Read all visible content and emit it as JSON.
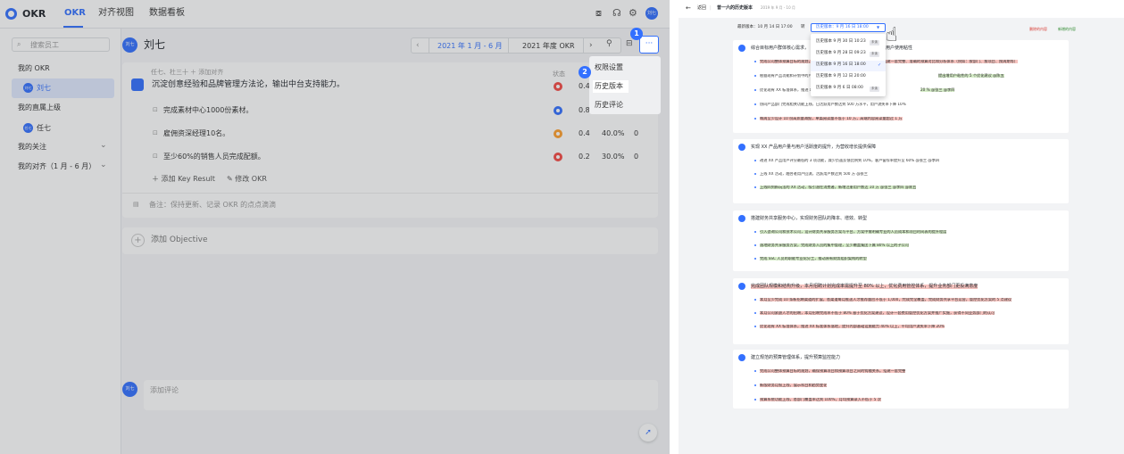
{
  "app": {
    "name": "OKR",
    "tabs": [
      "OKR",
      "对齐视图",
      "数据看板"
    ],
    "user_avatar": "刘七"
  },
  "sidebar": {
    "search_placeholder": "搜索员工",
    "my_okr": "我的 OKR",
    "me": "刘七",
    "leader_title": "我的直属上级",
    "leader": "任七",
    "follow": "我的关注",
    "align": "我的对齐（1 月 - 6 月）"
  },
  "header": {
    "name": "刘七",
    "avatar": "刘七",
    "period": "2021 年 1 月 - 6 月",
    "okr_year": "2021 年度 OKR"
  },
  "objective": {
    "align": "任七、杜三十",
    "add_align": "添加对齐",
    "title": "沉淀创意经验和品牌管理方法论，输出中台支持能力。",
    "status_label": "状态",
    "score": "0.4"
  },
  "krs": [
    {
      "text": "完成素材中心1000份素材。",
      "score": "0.8",
      "progress": "",
      "extra": ""
    },
    {
      "text": "雇佣资深经理10名。",
      "score": "0.4",
      "progress": "40.0%",
      "extra": "0"
    },
    {
      "text": "至少60%的销售人员完成配额。",
      "score": "0.2",
      "progress": "30.0%",
      "extra": "0"
    }
  ],
  "card_actions": {
    "add_kr": "添加 Key Result",
    "edit": "修改 OKR",
    "note": "备注：保持更新、记录 OKR 的点点滴滴"
  },
  "add_objective": "添加 Objective",
  "comment": {
    "avatar": "刘七",
    "placeholder": "添加评论"
  },
  "menu": {
    "items": [
      "权限设置",
      "历史版本",
      "历史评论"
    ]
  },
  "badges": [
    "1",
    "2"
  ],
  "doc": {
    "back": "返回",
    "title": "曾一六的历史版本",
    "date": "2019 年 9 月 - 10 月",
    "latest": "最新版本：10 月 14 日 17:00",
    "hist_label": "历史版本：9 月 16 日 18:00",
    "legend_del": "删除的内容",
    "legend_add": "新增的内容",
    "versions": [
      {
        "t": "历史版本 9 月 30 日 10:23",
        "tag": "未读"
      },
      {
        "t": "历史版本 9 月 28 日 09:23",
        "tag": "未读"
      },
      {
        "t": "历史版本 9 月 16 日 18:00",
        "tag": ""
      },
      {
        "t": "历史版本 9 月 12 日 20:00",
        "tag": ""
      },
      {
        "t": "历史版本 9 月 6 日 08:00",
        "tag": "未读"
      }
    ],
    "sections": [
      {
        "obj": "综合目标用户群体核心需求，",
        "obj_tail": "升用户使用粘性",
        "items": [
          "完成公司整体预算目标的规划，确保预算项目和预算项目之间的钩稽关系。搭建一套完整、准确的预算对比和分析体系（例如：按部门、按项目、按周期等）",
          "根据现有产品功能和计划中的产品功能，迭代优化预算体系。",
          "优化现有 XX 标准体系，推进 XX 标准体系落地",
          "协同产品部门完成相关功能上线，日活跃用户数达到 500 万水平，用户流失率下降 10%",
          "每周至少设计 10 份高质量海报，单篇阅读量不低于 10 万，高端内容阅读量超过 1 万"
        ],
        "ins": [
          "提出增用户粘性的 5 个优化建议 @陈五",
          "20 %  @张三 @李四"
        ]
      },
      {
        "obj": "实现 XX 产品用户量与用户活跃度的提升，为营收增长提供保障",
        "items": [
          "改进 XX 产品用户评分最低的 3 项功能，减少负面反馈比例到 10%，客户留存率提升至 60% @张三 @李四",
          "上线 XX 活动，融合老用户回流，活跃用户数达到 500 万 @张三",
          "上线四到新玩法的 XX 活动，吸引潜在消费者，新增注册用户数达 10 万 @张三 @李四 @陈五"
        ]
      },
      {
        "obj": "搭建财务共享服务中心，实现财务团队的降本、增效、转型",
        "items": [
          "引入咨询公司和技术公司，设计财务共享服务方案与平台，方案中需明确专业的人员成本和项目时间表的提升程度",
          "落地财务共享服务方案，完成财务人员的集中管理，至少覆盖集团下属 80% 以上的子公司",
          "完成 SSC 人员的职能专业化分工，推动原有财务组织架构的转型"
        ]
      },
      {
        "obj": "完成团队规模和结构升级，本月招聘计划完成率需提升至 80% 以上，优化费用管控体系，提升业务部门更投满意度",
        "items": [
          "本月至少完成 10 条新招聘渠道的扩展，各渠道每月推送人才推荐量应不低于 1,000，完成完全覆盖，完成财务共享平台运营，管控优化方案的 5 点建议",
          "本月公司紧缺人才的招聘，本月招聘完成率不低于 80% 基于优化方案建议，设计一套费用管控优化方案并推广实施，获得不同业务部门的认可",
          "优化现有 XX 标准体系，推进 XX 标准体系落地，提升内部基础设施能力 40% 以上，平均用户流失率下降 20%"
        ]
      },
      {
        "obj": "建立规范的预算管理体系，提升预算监控能力",
        "items": [
          "完成公司整体预算目标的规划，确保预算项目和预算项目之间的钩稽关系。搭建一套完整",
          "新版财务月报上线，展示科目和趋势变化",
          "预算系统功能上线，各部门覆盖率达到 100%，月均预算录入不低于 5 次"
        ]
      }
    ]
  }
}
